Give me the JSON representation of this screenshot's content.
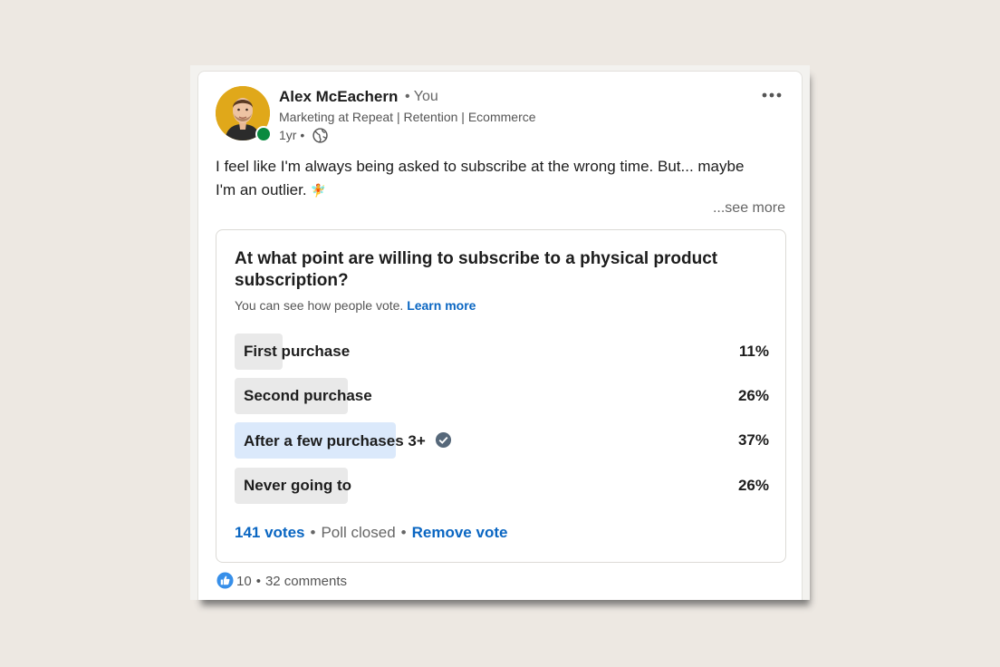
{
  "colors": {
    "background": "#ede8e2",
    "link_blue": "#0a66c2",
    "presence_green": "#0a8a3f",
    "bar_default": "#e9e9e9",
    "bar_selected": "#dbe9fb",
    "avatar_bg": "#e0a81a"
  },
  "author": {
    "name": "Alex McEachern",
    "you_badge": "• You",
    "headline": "Marketing at Repeat | Retention | Ecommerce",
    "time": "1yr •",
    "visibility_icon": "globe-icon",
    "avatar_icon": "profile-photo",
    "presence_icon": "online-dot"
  },
  "menu": {
    "icon": "ellipsis-icon"
  },
  "post": {
    "text_line_1": "I feel like I'm always being asked to subscribe at the wrong time. But... maybe",
    "text_line_2": "I'm an outlier.",
    "emoji": "🧚",
    "see_more": "...see more"
  },
  "poll": {
    "question": "At what point are willing to subscribe to a physical product subscription?",
    "notice": "You can see how people vote.",
    "learn_more": "Learn more",
    "options": [
      {
        "label": "First purchase",
        "percent_label": "11%",
        "percent": 11,
        "selected": false
      },
      {
        "label": "Second purchase",
        "percent_label": "26%",
        "percent": 26,
        "selected": false
      },
      {
        "label": "After a few purchases 3+",
        "percent_label": "37%",
        "percent": 37,
        "selected": true,
        "icon": "check-circle-icon"
      },
      {
        "label": "Never going to",
        "percent_label": "26%",
        "percent": 26,
        "selected": false
      }
    ],
    "votes": "141 votes",
    "separator": "•",
    "status": "Poll closed",
    "remove_vote": "Remove vote"
  },
  "social": {
    "like_icon": "like-icon",
    "reactions": "10",
    "separator": "•",
    "comments": "32 comments"
  }
}
